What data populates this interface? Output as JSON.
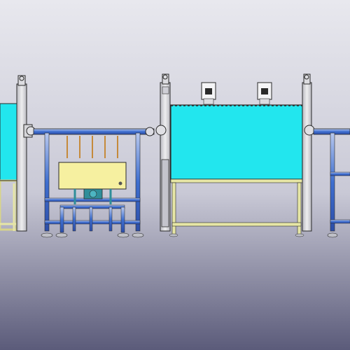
{
  "scene": {
    "kind": "cad-assembly-view",
    "colors": {
      "bg_top": "#e8e8ee",
      "bg_mid": "#c9c9d6",
      "bg_bottom": "#5b5b7a",
      "tank_fill": "#22e6ee",
      "pipe_blue": "#3f6fd0",
      "pipe_light": "#b8c8ee",
      "frame_yellow": "#e6e6a6",
      "panel_yellow": "#f6f0a0",
      "column_gray": "#cfcfd3",
      "outline": "#2a2a2a",
      "rod_orange": "#c58a3b",
      "pump_teal": "#2f8e9a"
    },
    "components": [
      {
        "name": "left-tank",
        "type": "tank"
      },
      {
        "name": "left-column",
        "type": "lift-column"
      },
      {
        "name": "middle-pipe-rack",
        "type": "rack"
      },
      {
        "name": "control-box",
        "type": "panel"
      },
      {
        "name": "right-column",
        "type": "lift-column"
      },
      {
        "name": "right-tank",
        "type": "tank"
      },
      {
        "name": "sensor-left",
        "type": "sensor-head"
      },
      {
        "name": "sensor-right",
        "type": "sensor-head"
      },
      {
        "name": "right-pipe-rack",
        "type": "rack"
      }
    ]
  }
}
